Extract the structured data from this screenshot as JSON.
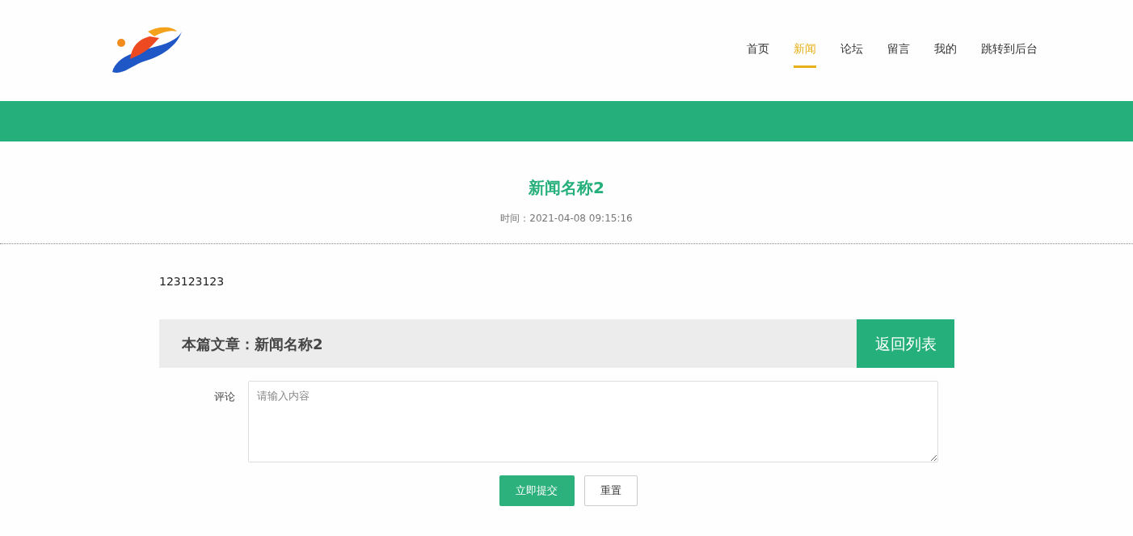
{
  "nav": [
    {
      "label": "首页",
      "selected": false
    },
    {
      "label": "新闻",
      "selected": true
    },
    {
      "label": "论坛",
      "selected": false
    },
    {
      "label": "留言",
      "selected": false
    },
    {
      "label": "我的",
      "selected": false
    },
    {
      "label": "跳转到后台",
      "selected": false
    }
  ],
  "article": {
    "title": "新闻名称2",
    "time": "时间：2021-04-08 09:15:16",
    "body": "123123123"
  },
  "article_bar": {
    "label": "本篇文章：新闻名称2",
    "back_button": "返回列表"
  },
  "comment_form": {
    "label": "评论",
    "placeholder": "请输入内容",
    "submit": "立即提交",
    "reset": "重置"
  }
}
